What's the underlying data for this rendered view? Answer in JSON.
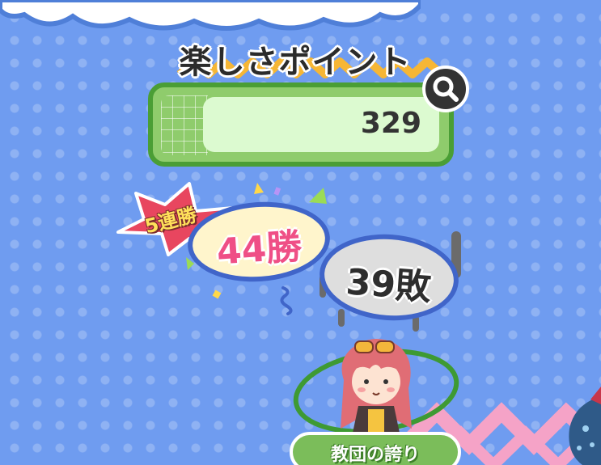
{
  "title": "楽しさポイント",
  "score": {
    "value": "329"
  },
  "streak": {
    "label": "5連勝"
  },
  "wins": {
    "label": "44勝"
  },
  "losses": {
    "label": "39敗"
  },
  "badge": {
    "label": "教団の誇り"
  },
  "icons": {
    "search": "magnifier-icon",
    "streak": "star-burst-icon"
  },
  "colors": {
    "background": "#6f9cf0",
    "panel_green": "#8fcc6c",
    "panel_border": "#4a9e35",
    "wins_pink": "#ef4f86",
    "ring_blue": "#4065c9",
    "streak_red": "#e8465f"
  }
}
